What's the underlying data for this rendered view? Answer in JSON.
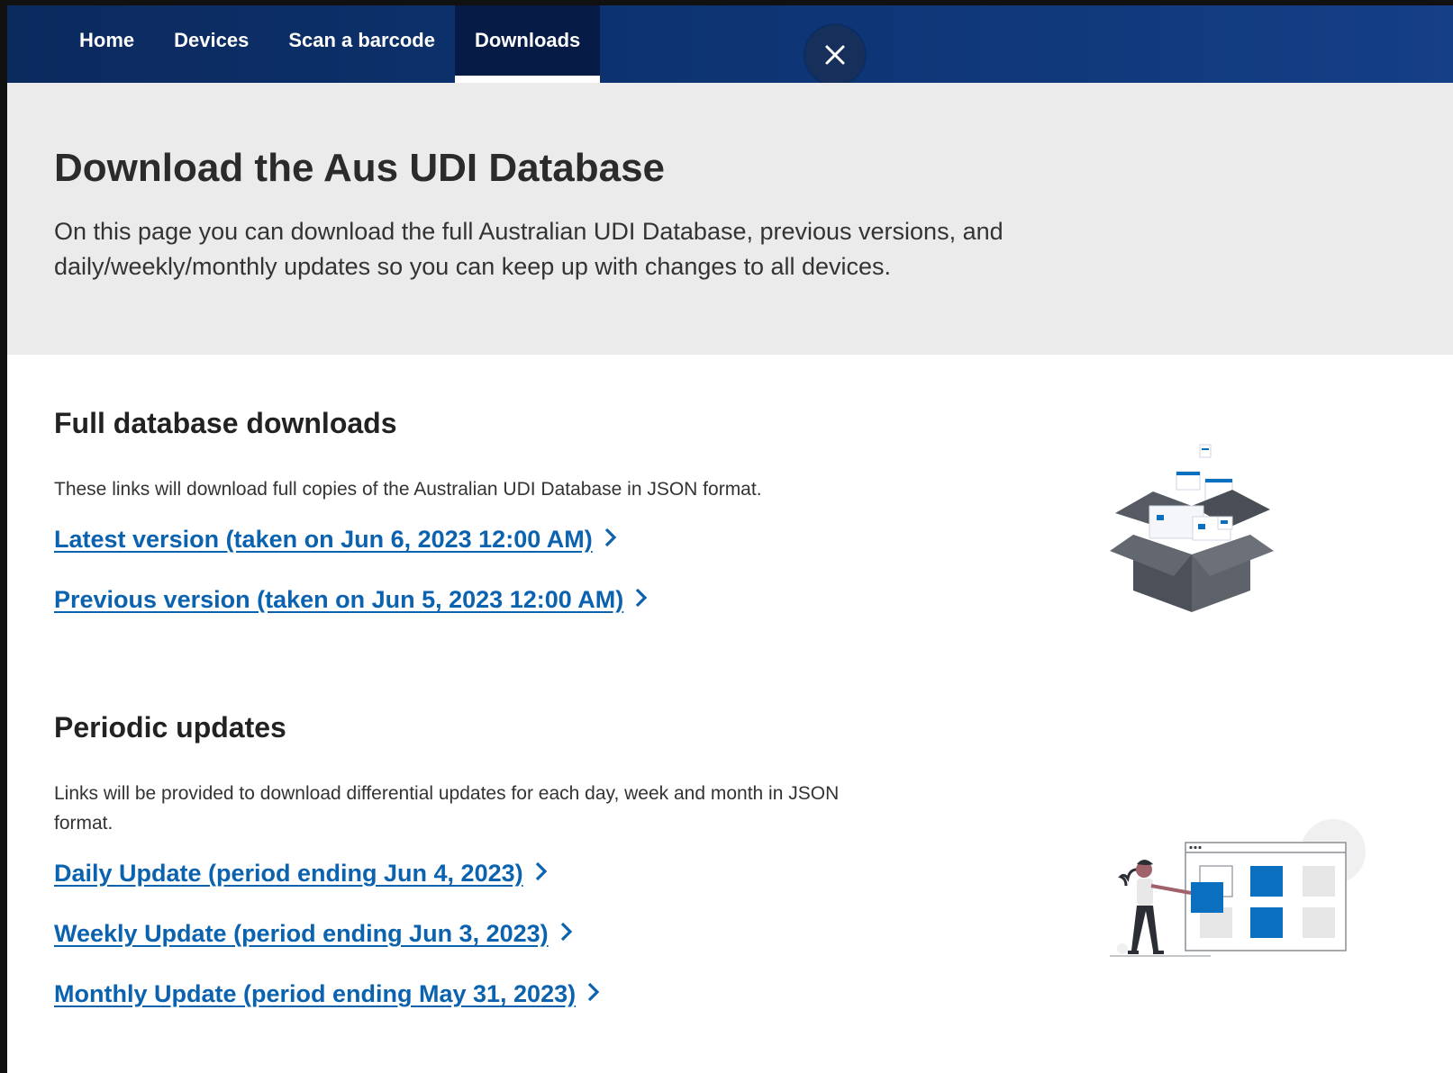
{
  "nav": {
    "items": [
      {
        "label": "Home",
        "active": false
      },
      {
        "label": "Devices",
        "active": false
      },
      {
        "label": "Scan a barcode",
        "active": false
      },
      {
        "label": "Downloads",
        "active": true
      }
    ]
  },
  "hero": {
    "title": "Download the Aus UDI Database",
    "description": "On this page you can download the full Australian UDI Database, previous versions, and daily/weekly/monthly updates so you can keep up with changes to all devices."
  },
  "full_downloads": {
    "heading": "Full database downloads",
    "description": "These links will download full copies of the Australian UDI Database in JSON format.",
    "links": [
      {
        "label": "Latest version (taken on Jun 6, 2023 12:00 AM)"
      },
      {
        "label": "Previous version (taken on Jun 5, 2023 12:00 AM)"
      }
    ]
  },
  "periodic": {
    "heading": "Periodic updates",
    "description": "Links will be provided to download differential updates for each day, week and month in JSON format.",
    "links": [
      {
        "label": "Daily Update (period ending Jun 4, 2023)"
      },
      {
        "label": "Weekly Update (period ending Jun 3, 2023)"
      },
      {
        "label": "Monthly Update (period ending May 31, 2023)"
      }
    ]
  },
  "icons": {
    "close": "close-icon",
    "chevron": "chevron-right-icon",
    "box_illustration": "open-box-illustration",
    "person_illustration": "person-with-blocks-illustration"
  },
  "colors": {
    "nav_bg": "#0e3677",
    "nav_active": "#061c47",
    "hero_bg": "#ebebeb",
    "link": "#0b62ae",
    "accent_blue": "#0a6fbf"
  }
}
